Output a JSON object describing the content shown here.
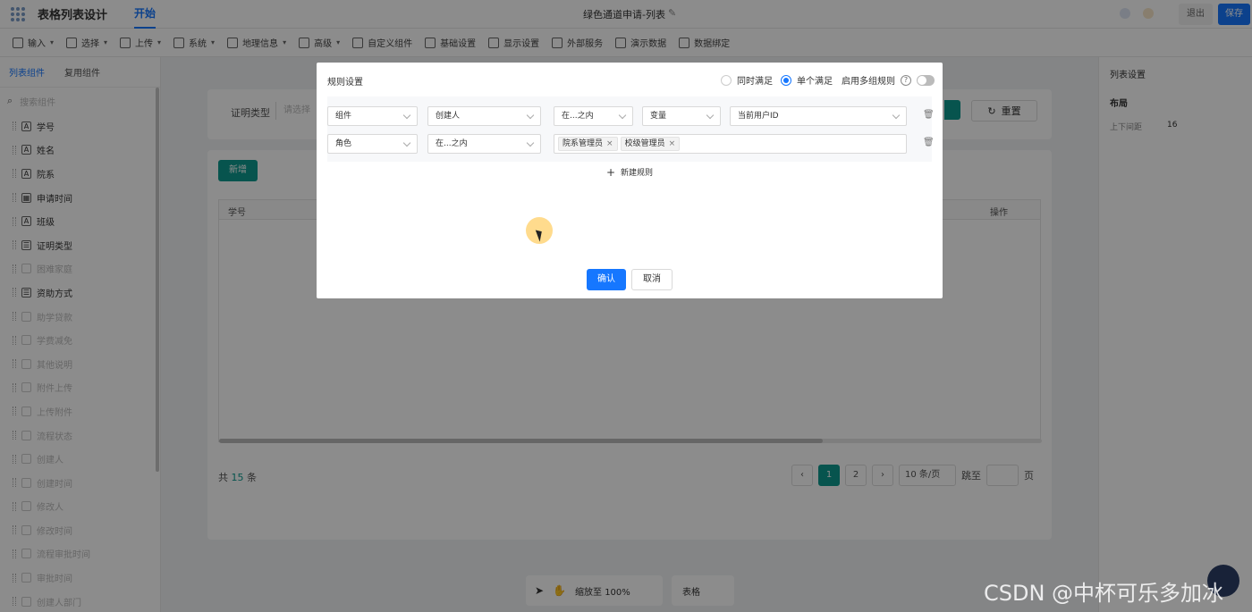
{
  "app": {
    "title": "表格列表设计",
    "tab_start": "开始",
    "doc_title": "绿色通道申请-列表",
    "exit_label": "退出",
    "save_label": "保存"
  },
  "toolbar": {
    "items": [
      "输入",
      "选择",
      "上传",
      "系统",
      "地理信息",
      "高级",
      "自定义组件",
      "基础设置",
      "显示设置",
      "外部服务",
      "演示数据",
      "数据绑定"
    ]
  },
  "left_panel": {
    "tabs": [
      "列表组件",
      "复用组件"
    ],
    "search_placeholder": "搜索组件",
    "items": [
      "学号",
      "姓名",
      "院系",
      "申请时间",
      "班级",
      "证明类型",
      "困难家庭",
      "资助方式",
      "助学贷款",
      "学费减免",
      "其他说明",
      "附件上传",
      "上传附件",
      "流程状态",
      "创建人",
      "创建时间",
      "修改人",
      "修改时间",
      "流程审批时间",
      "审批时间",
      "创建人部门"
    ]
  },
  "main": {
    "filter_label": "证明类型",
    "filter_placeholder": "请选择",
    "reset_label": "重置",
    "new_label": "新增",
    "col_first": "学号",
    "col_action": "操作",
    "total_prefix": "共",
    "total_count": "15",
    "total_suffix": "条",
    "pages": [
      "1",
      "2"
    ],
    "page_size": "10 条/页",
    "jump_label": "跳至",
    "page_unit": "页"
  },
  "bottom": {
    "zoom_label": "缩放至 100%",
    "table_label": "表格"
  },
  "right_panel": {
    "title": "列表设置",
    "section": "布局",
    "spacing_label": "上下间距",
    "spacing_value": "16"
  },
  "dialog": {
    "title": "规则设置",
    "radio_all": "同时满足",
    "radio_single": "单个满足",
    "multi_group_label": "启用多组规则",
    "rule1": {
      "type": "组件",
      "field": "创建人",
      "op": "在...之内",
      "value_type": "变量",
      "value": "当前用户ID"
    },
    "rule2": {
      "type": "角色",
      "op": "在...之内",
      "tags": [
        "院系管理员",
        "校级管理员"
      ]
    },
    "add_rule_label": "新建规则",
    "ok_label": "确认",
    "cancel_label": "取消"
  },
  "watermark": "CSDN @中杯可乐多加冰",
  "colors": {
    "primary": "#1677ff",
    "accent": "#0d9a8e"
  }
}
